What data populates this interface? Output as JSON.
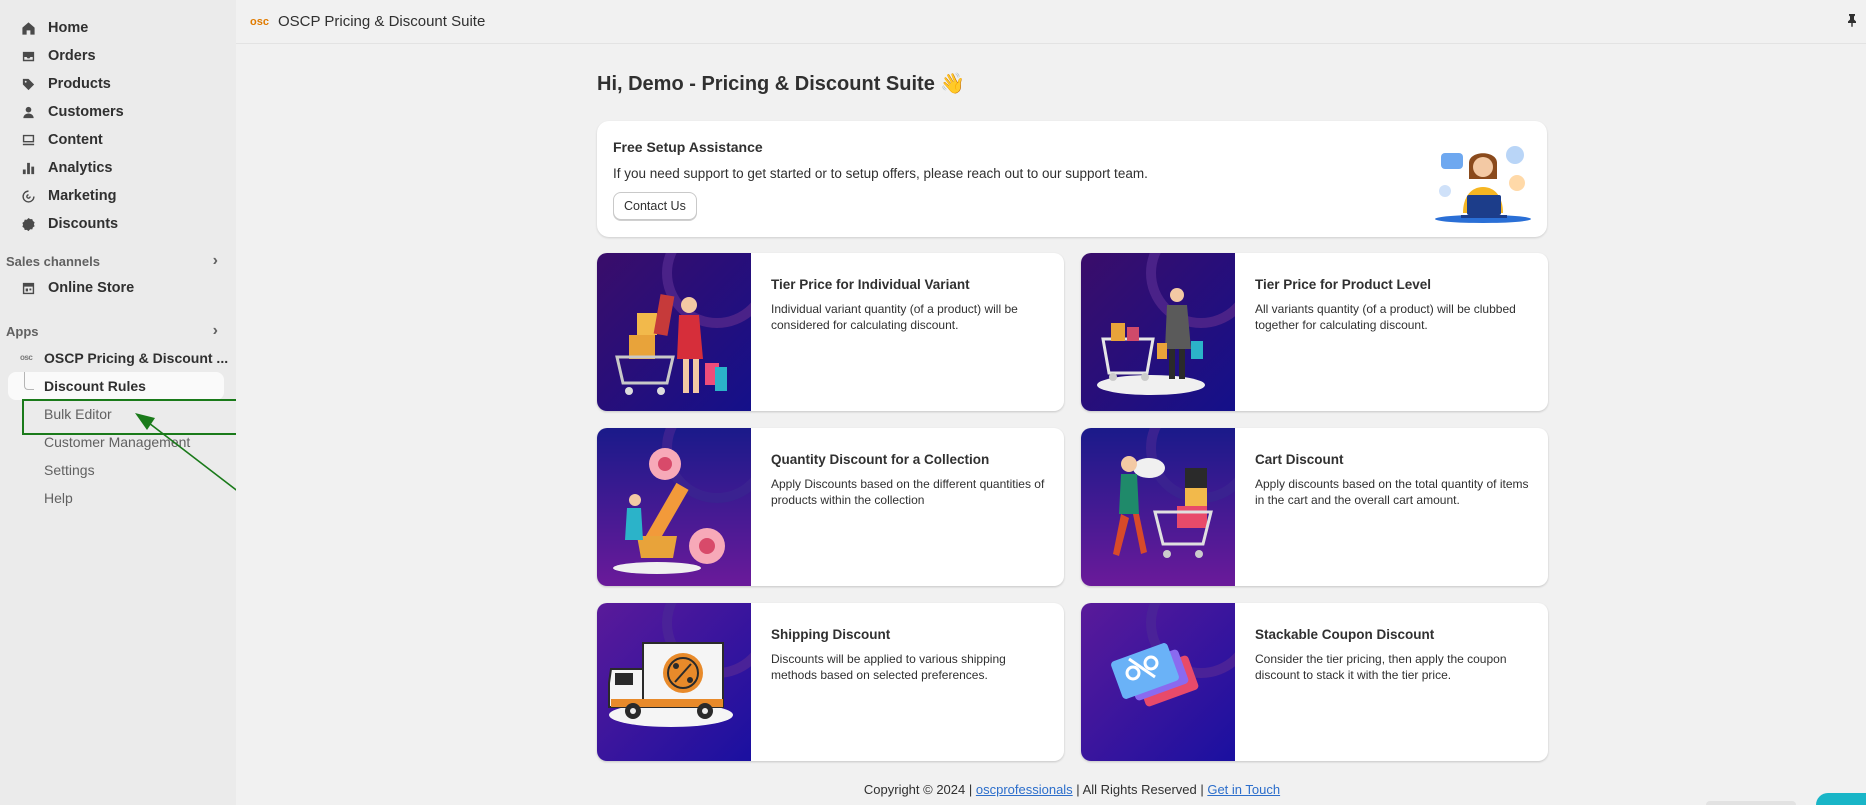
{
  "sidebar": {
    "nav": [
      {
        "label": "Home",
        "icon": "home-icon"
      },
      {
        "label": "Orders",
        "icon": "inbox-icon"
      },
      {
        "label": "Products",
        "icon": "tag-icon"
      },
      {
        "label": "Customers",
        "icon": "person-icon"
      },
      {
        "label": "Content",
        "icon": "content-icon"
      },
      {
        "label": "Analytics",
        "icon": "bar-chart-icon"
      },
      {
        "label": "Marketing",
        "icon": "target-icon"
      },
      {
        "label": "Discounts",
        "icon": "discount-badge-icon"
      }
    ],
    "sales_channels_label": "Sales channels",
    "online_store_label": "Online Store",
    "apps_label": "Apps",
    "app_name": "OSCP Pricing & Discount ...",
    "app_subitems": [
      "Discount Rules",
      "Bulk Editor",
      "Customer Management",
      "Settings",
      "Help"
    ]
  },
  "topbar": {
    "logo_text": "osc",
    "title": "OSCP Pricing & Discount Suite"
  },
  "main": {
    "greeting": "Hi, Demo - Pricing & Discount Suite 👋",
    "setup": {
      "title": "Free Setup Assistance",
      "description": "If you need support to get started or to setup offers, please reach out to our support team.",
      "button": "Contact Us"
    },
    "cards": [
      {
        "title": "Tier Price for Individual Variant",
        "description": "Individual variant quantity (of a product) will be considered for calculating discount.",
        "thumb": "shopping-sale-illustration"
      },
      {
        "title": "Tier Price for Product Level",
        "description": "All variants quantity (of a product) will be clubbed together for calculating discount.",
        "thumb": "shopper-cart-illustration"
      },
      {
        "title": "Quantity Discount for a Collection",
        "description": "Apply Discounts based on the different quantities of products within the collection",
        "thumb": "percent-sign-illustration"
      },
      {
        "title": "Cart Discount",
        "description": "Apply discounts based on the total quantity of items in the cart and the overall cart amount.",
        "thumb": "sale-cart-illustration"
      },
      {
        "title": "Shipping Discount",
        "description": "Discounts will be applied to various shipping methods based on selected preferences.",
        "thumb": "delivery-truck-illustration"
      },
      {
        "title": "Stackable Coupon Discount",
        "description": "Consider the tier pricing, then apply the coupon discount to stack it with the tier price.",
        "thumb": "coupon-tickets-illustration"
      }
    ],
    "footer": {
      "prefix": "Copyright © 2024 | ",
      "link1": "oscprofessionals",
      "middle": " | All Rights Reserved | ",
      "link2": "Get in Touch"
    }
  },
  "colors": {
    "highlight": "#1a7a1a",
    "thumb_bg_dark": "#1a0a6e",
    "thumb_bg_purple": "#5a1a9a",
    "link": "#2c6ecb"
  }
}
